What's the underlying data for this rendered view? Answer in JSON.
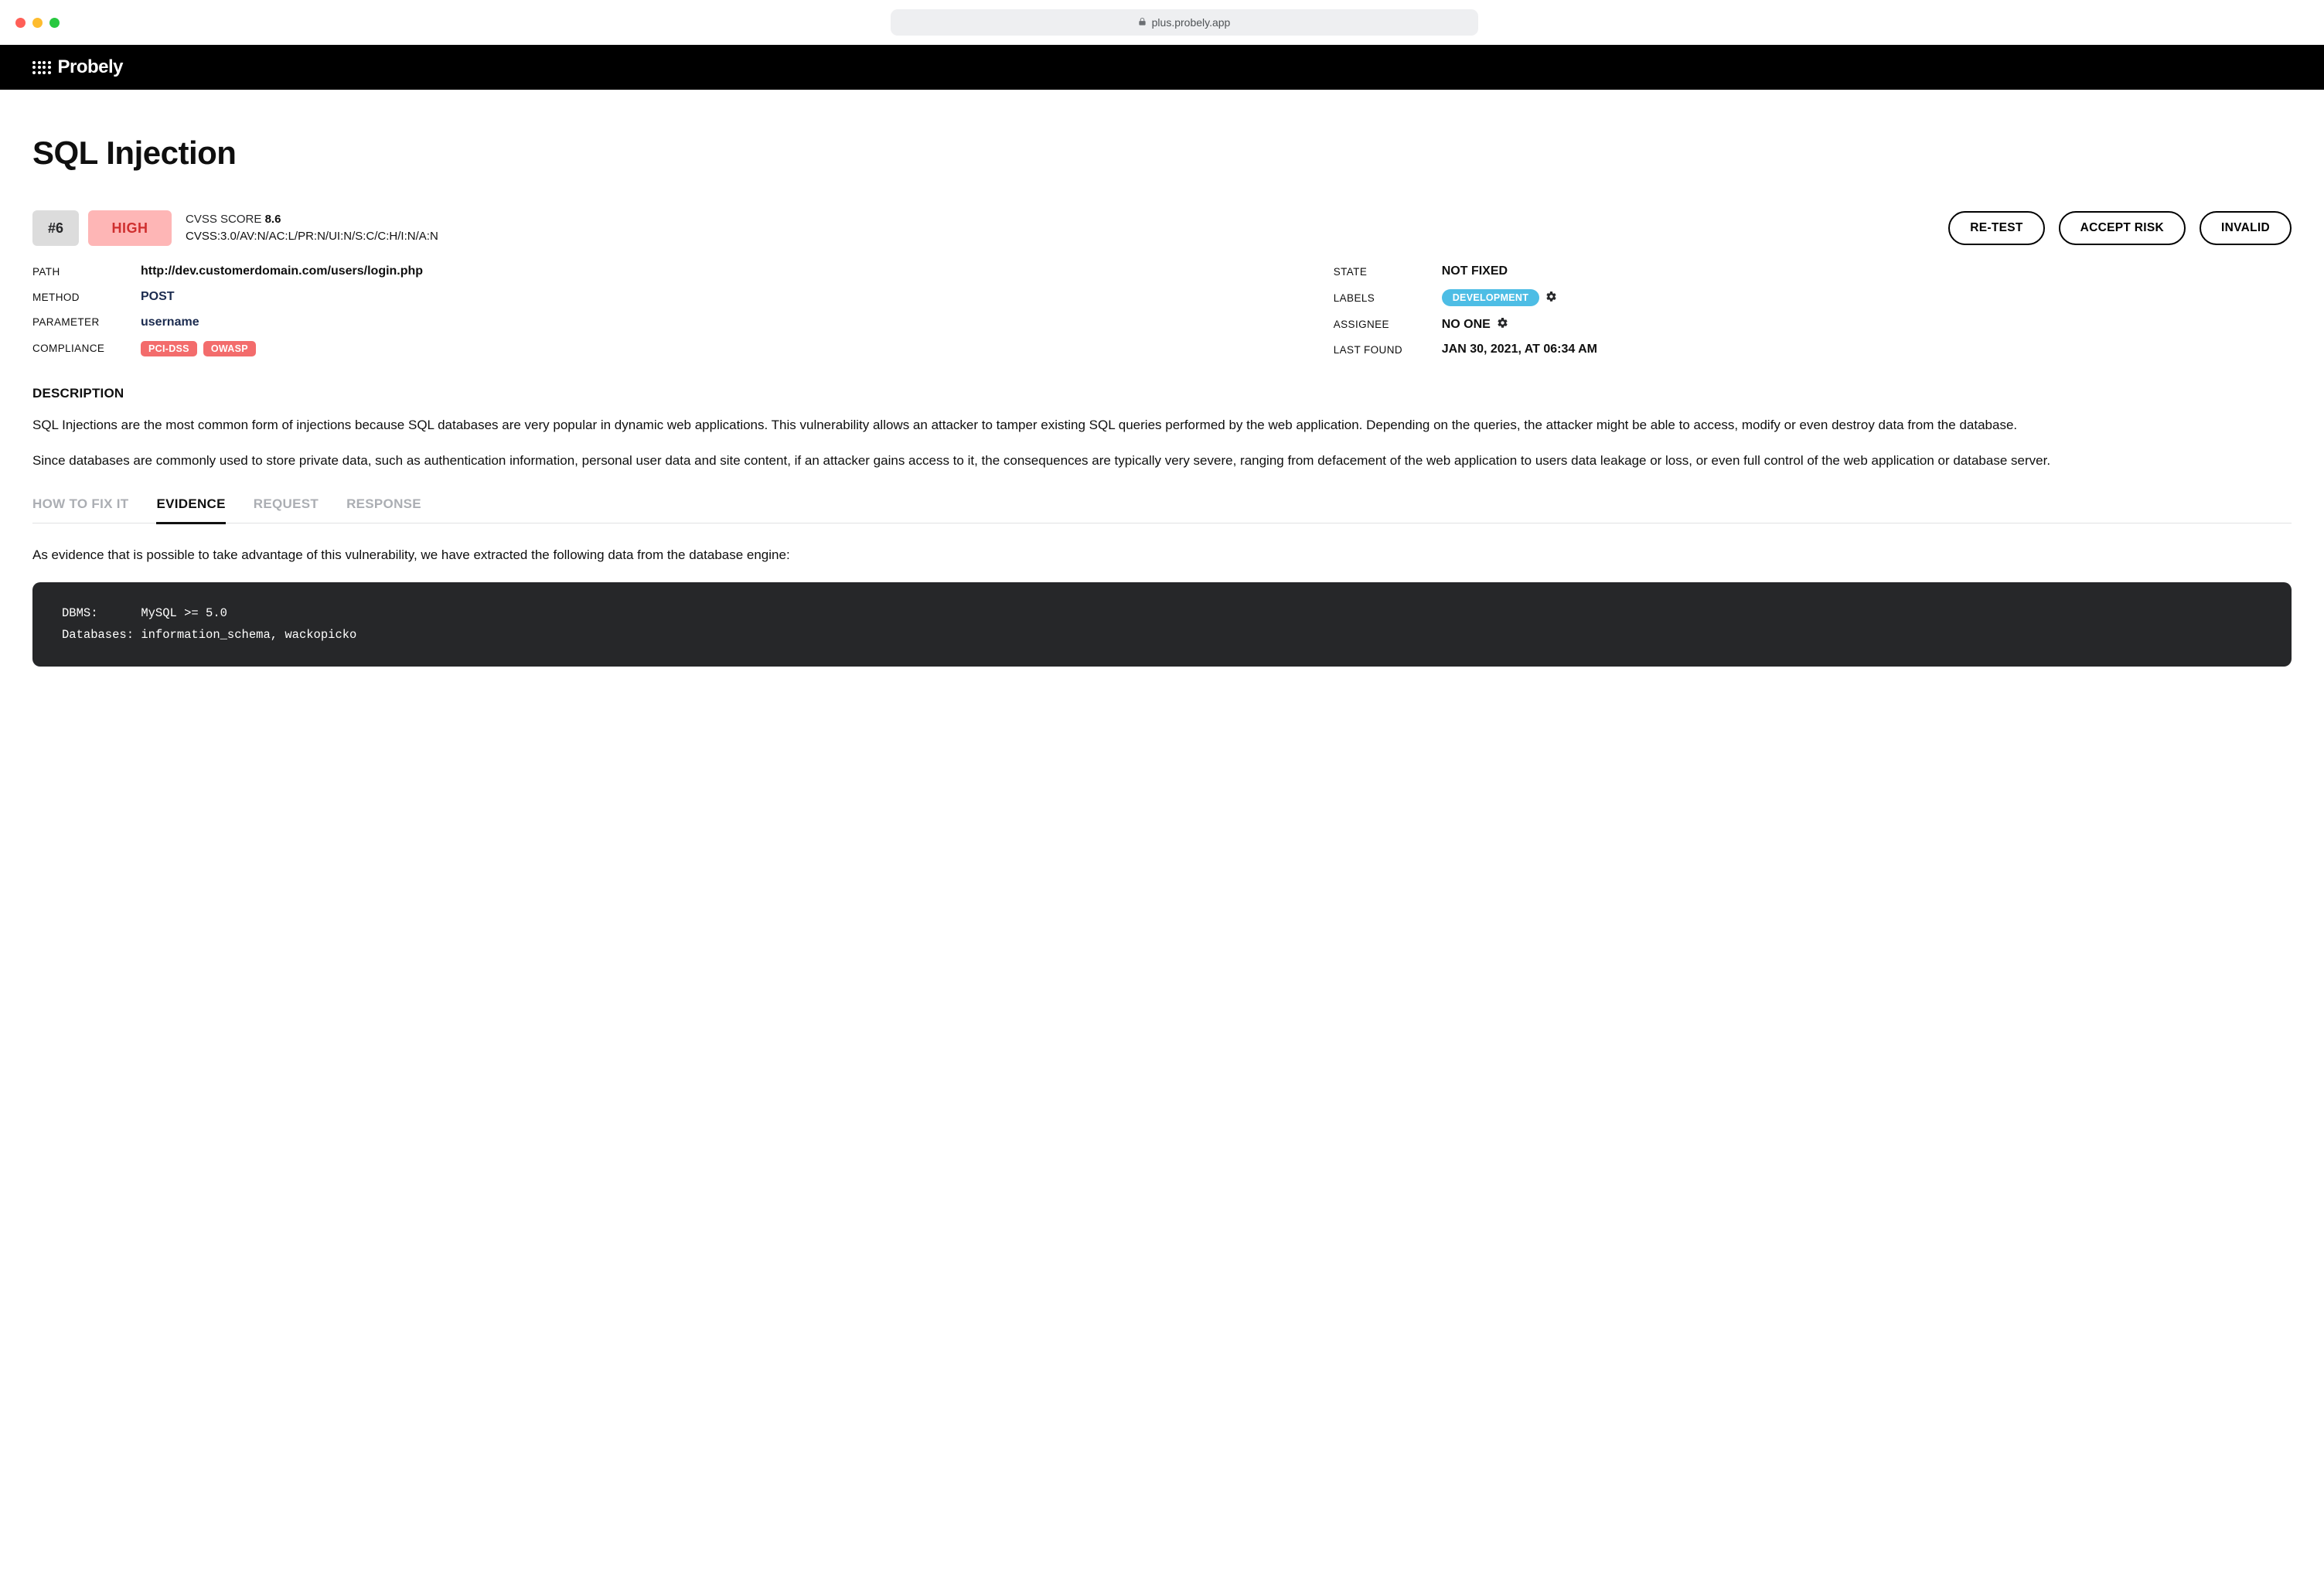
{
  "browser": {
    "url": "plus.probely.app"
  },
  "brand": {
    "name": "Probely"
  },
  "header": {
    "title": "SQL Injection"
  },
  "finding": {
    "id": "#6",
    "severity": "HIGH",
    "cvss": {
      "label": "CVSS SCORE",
      "score": "8.6",
      "vector": "CVSS:3.0/AV:N/AC:L/PR:N/UI:N/S:C/C:H/I:N/A:N"
    }
  },
  "actions": {
    "retest": "RE-TEST",
    "accept_risk": "ACCEPT RISK",
    "invalid": "INVALID"
  },
  "meta_left": {
    "path": {
      "label": "PATH",
      "value": "http://dev.customerdomain.com/users/login.php"
    },
    "method": {
      "label": "METHOD",
      "value": "POST"
    },
    "parameter": {
      "label": "PARAMETER",
      "value": "username"
    },
    "compliance": {
      "label": "COMPLIANCE",
      "values": [
        "PCI-DSS",
        "OWASP"
      ]
    }
  },
  "meta_right": {
    "state": {
      "label": "STATE",
      "value": "NOT FIXED"
    },
    "labels": {
      "label": "LABELS",
      "values": [
        "DEVELOPMENT"
      ]
    },
    "assignee": {
      "label": "ASSIGNEE",
      "value": "NO ONE"
    },
    "last_found": {
      "label": "LAST FOUND",
      "value": "JAN 30, 2021, AT 06:34 AM"
    }
  },
  "description": {
    "heading": "DESCRIPTION",
    "paragraphs": [
      "SQL Injections are the most common form of injections because SQL databases are very popular in dynamic web applications. This vulnerability allows an attacker to tamper existing SQL queries performed by the web application. Depending on the queries, the attacker might be able to access, modify or even destroy data from the database.",
      "Since databases are commonly used to store private data, such as authentication information, personal user data and site content, if an attacker gains access to it, the consequences are typically very severe, ranging from defacement of the web application to users data leakage or loss, or even full control of the web application or database server."
    ]
  },
  "tabs": {
    "how_to_fix": "HOW TO FIX IT",
    "evidence": "EVIDENCE",
    "request": "REQUEST",
    "response": "RESPONSE"
  },
  "evidence": {
    "intro": "As evidence that is possible to take advantage of this vulnerability, we have extracted the following data from the database engine:",
    "code": "DBMS:      MySQL >= 5.0\nDatabases: information_schema, wackopicko"
  }
}
